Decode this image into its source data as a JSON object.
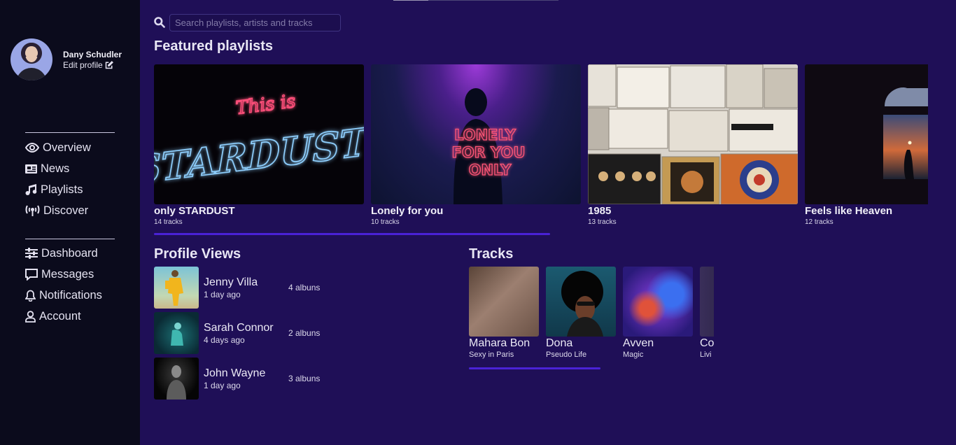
{
  "user": {
    "name": "Dany Schudler",
    "edit_label": "Edit profile"
  },
  "nav_primary": [
    {
      "label": "Overview",
      "icon": "eye-icon"
    },
    {
      "label": "News",
      "icon": "newspaper-icon"
    },
    {
      "label": "Playlists",
      "icon": "music-note-icon"
    },
    {
      "label": "Discover",
      "icon": "broadcast-icon"
    }
  ],
  "nav_secondary": [
    {
      "label": "Dashboard",
      "icon": "sliders-icon"
    },
    {
      "label": "Messages",
      "icon": "message-icon"
    },
    {
      "label": "Notifications",
      "icon": "bell-icon"
    },
    {
      "label": "Account",
      "icon": "user-icon"
    }
  ],
  "search": {
    "placeholder": "Search playlists, artists and tracks",
    "value": ""
  },
  "featured": {
    "title": "Featured playlists",
    "playlists": [
      {
        "name": "only STARDUST",
        "tracks": "14 tracks",
        "art_line1": "This is",
        "art_line2": "STARDUST"
      },
      {
        "name": "Lonely for you",
        "tracks": "10 tracks",
        "art_line1": "LONELY",
        "art_line2": "FOR YOU",
        "art_line3": "ONLY"
      },
      {
        "name": "1985",
        "tracks": "13 tracks"
      },
      {
        "name": "Feels like Heaven",
        "tracks": "12 tracks"
      }
    ]
  },
  "profile_views": {
    "title": "Profile Views",
    "items": [
      {
        "name": "Jenny Villa",
        "time": "1 day ago",
        "albums": "4 albuns"
      },
      {
        "name": "Sarah Connor",
        "time": "4 days ago",
        "albums": "2 albuns"
      },
      {
        "name": "John Wayne",
        "time": "1 day ago",
        "albums": "3 albuns"
      }
    ]
  },
  "tracks": {
    "title": "Tracks",
    "items": [
      {
        "name": "Mahara Bon",
        "sub": "Sexy in Paris"
      },
      {
        "name": "Dona",
        "sub": "Pseudo Life"
      },
      {
        "name": "Avven",
        "sub": "Magic"
      },
      {
        "name": "Co",
        "sub": "Livi"
      }
    ]
  },
  "colors": {
    "sidebar_bg": "#0b0b1c",
    "main_bg": "#1f0f57",
    "accent": "#4a22d6"
  }
}
